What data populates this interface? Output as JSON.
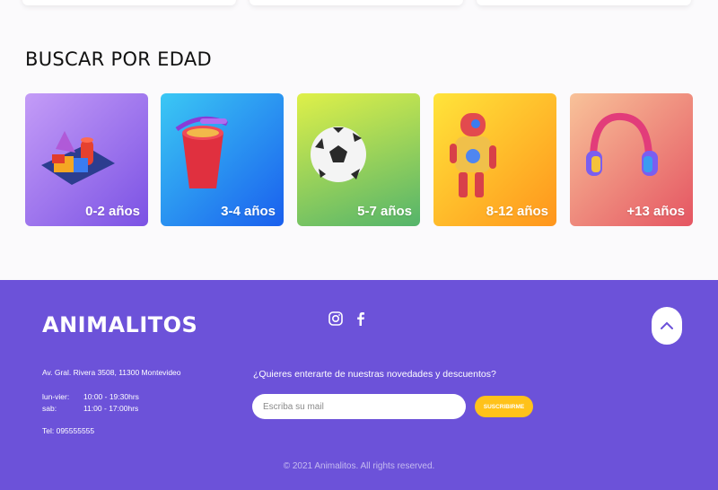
{
  "section": {
    "title": "BUSCAR POR EDAD"
  },
  "age_categories": [
    {
      "label": "0-2 años",
      "icon": "shapes-toy-icon",
      "gradient": [
        "#b08af5",
        "#7f55e6"
      ]
    },
    {
      "label": "3-4 años",
      "icon": "sand-bucket-icon",
      "gradient": [
        "#38b8f2",
        "#1f6ff0"
      ]
    },
    {
      "label": "5-7 años",
      "icon": "soccer-ball-icon",
      "gradient": [
        "#c2e24a",
        "#4fb16a"
      ]
    },
    {
      "label": "8-12 años",
      "icon": "robot-icon",
      "gradient": [
        "#ffd836",
        "#ff9a1e"
      ]
    },
    {
      "label": "+13 años",
      "icon": "headphones-icon",
      "gradient": [
        "#f7b28a",
        "#e65b5f"
      ]
    }
  ],
  "footer": {
    "logo": "ANIMALITOS",
    "social": [
      {
        "name": "instagram-icon"
      },
      {
        "name": "facebook-icon"
      }
    ],
    "address": "Av. Gral. Rivera 3508, 11300 Montevideo",
    "hours": [
      {
        "day": "lun-vier:",
        "time": "10:00 - 19:30hrs"
      },
      {
        "day": "sab:",
        "time": "11:00 - 17:00hrs"
      }
    ],
    "phone": "Tel: 095555555",
    "newsletter_question": "¿Quieres enterarte de nuestras novedades y descuentos?",
    "email_placeholder": "Escriba su mail",
    "subscribe_label": "SUSCRIBIRME",
    "copyright": "© 2021 Animalitos. All rights reserved."
  },
  "colors": {
    "footer_bg": "#6c52d9",
    "accent": "#ffc21a"
  }
}
